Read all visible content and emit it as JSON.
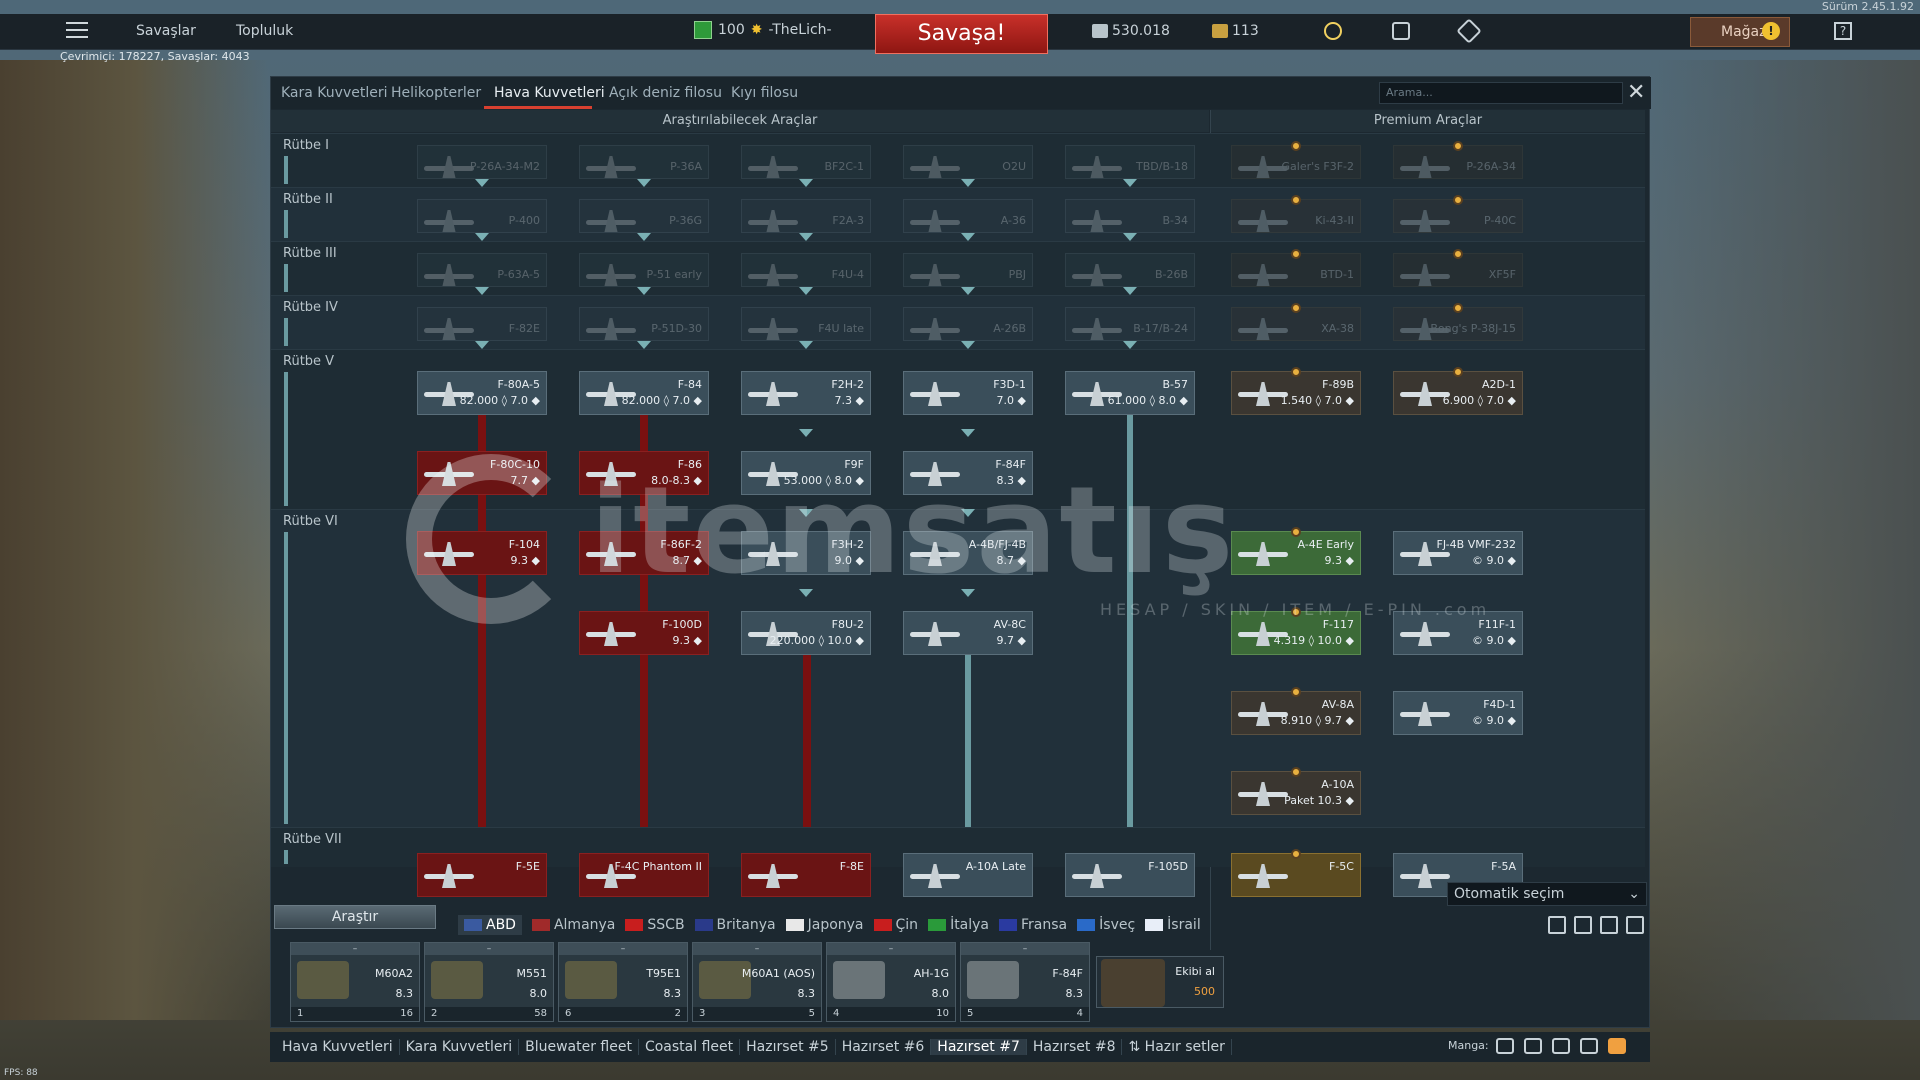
{
  "version": "Sürüm 2.45.1.92",
  "topbar": {
    "nav": [
      "Savaşlar",
      "Topluluk"
    ],
    "level": "100",
    "player": "-TheLich-",
    "battle_label": "Savaşa!",
    "silver": "530.018",
    "gold": "113",
    "shop_label": "Mağaza",
    "warn": "!",
    "help": "?"
  },
  "online": "Çevrimiçi: 178227, Savaşlar: 4043",
  "tabs": [
    "Kara Kuvvetleri",
    "Helikopterler",
    "Hava Kuvvetleri",
    "Açık deniz filosu",
    "Kıyı filosu"
  ],
  "search_placeholder": "Arama...",
  "columns": {
    "research": "Araştırılabilecek Araçlar",
    "premium": "Premium Araçlar"
  },
  "ranks": [
    "Rütbe I",
    "Rütbe II",
    "Rütbe III",
    "Rütbe IV",
    "Rütbe V",
    "Rütbe VI",
    "Rütbe VII"
  ],
  "faded_cards": [
    [
      "P-26A-34-M2",
      "P-36A",
      "BF2C-1",
      "O2U",
      "TBD/B-18",
      "Galer's F3F-2",
      "P-26A-34"
    ],
    [
      "P-400",
      "P-36G",
      "F2A-3",
      "A-36",
      "B-34",
      "Ki-43-II",
      "P-40C"
    ],
    [
      "P-63A-5",
      "P-51 early",
      "F4U-4",
      "PBJ",
      "B-26B",
      "BTD-1",
      "XF5F"
    ],
    [
      "F-82E",
      "P-51D-30",
      "F4U late",
      "A-26B",
      "B-17/B-24",
      "XA-38",
      "Bong's P-38J-15"
    ]
  ],
  "rank5": [
    {
      "name": "F-80A-5",
      "br": "82.000 ◊ 7.0 ◆",
      "style": "normal"
    },
    {
      "name": "F-84",
      "br": "82.000 ◊ 7.0 ◆",
      "style": "normal"
    },
    {
      "name": "F2H-2",
      "br": "7.3 ◆",
      "style": "normal"
    },
    {
      "name": "F3D-1",
      "br": "7.0 ◆",
      "style": "normal"
    },
    {
      "name": "B-57",
      "br": "61.000 ◊ 8.0 ◆",
      "style": "normal"
    },
    {
      "name": "F-89B",
      "br": "1.540 ◊ 7.0 ◆",
      "style": "prem"
    },
    {
      "name": "A2D-1",
      "br": "6.900 ◊ 7.0 ◆",
      "style": "prem"
    },
    {
      "name": "F-80C-10",
      "br": "7.7 ◆",
      "style": "red"
    },
    {
      "name": "F-86",
      "br": "8.0-8.3 ◆",
      "style": "red"
    },
    {
      "name": "F9F",
      "br": "53.000 ◊ 8.0 ◆",
      "style": "normal"
    },
    {
      "name": "F-84F",
      "br": "8.3 ◆",
      "style": "normal"
    }
  ],
  "rank6": [
    {
      "name": "F-104",
      "br": "9.3 ◆",
      "style": "red"
    },
    {
      "name": "F-86F-2",
      "br": "8.7 ◆",
      "style": "red"
    },
    {
      "name": "F3H-2",
      "br": "9.0 ◆",
      "style": "normal"
    },
    {
      "name": "A-4B/FJ-4B",
      "br": "8.7 ◆",
      "style": "normal"
    },
    {
      "name": "A-4E Early",
      "br": "9.3 ◆",
      "style": "green"
    },
    {
      "name": "FJ-4B VMF-232",
      "br": "© 9.0 ◆",
      "style": "normal"
    },
    {
      "name": "F-100D",
      "br": "9.3 ◆",
      "style": "red"
    },
    {
      "name": "F8U-2",
      "br": "220.000 ◊ 10.0 ◆",
      "style": "normal"
    },
    {
      "name": "AV-8C",
      "br": "9.7 ◆",
      "style": "normal"
    },
    {
      "name": "F-117",
      "br": "4.319 ◊ 10.0 ◆",
      "style": "green"
    },
    {
      "name": "F11F-1",
      "br": "© 9.0 ◆",
      "style": "normal"
    },
    {
      "name": "AV-8A",
      "br": "8.910 ◊ 9.7 ◆",
      "style": "prem"
    },
    {
      "name": "F4D-1",
      "br": "© 9.0 ◆",
      "style": "normal"
    },
    {
      "name": "A-10A",
      "br": "Paket 10.3 ◆",
      "style": "prem"
    }
  ],
  "rank7": [
    {
      "name": "F-5E",
      "style": "red"
    },
    {
      "name": "F-4C Phantom II",
      "style": "red"
    },
    {
      "name": "F-8E",
      "style": "red"
    },
    {
      "name": "A-10A Late",
      "style": "normal"
    },
    {
      "name": "F-105D",
      "style": "normal"
    },
    {
      "name": "F-5C",
      "style": "gold"
    },
    {
      "name": "F-5A",
      "style": "normal"
    }
  ],
  "autosel": "Otomatik seçim",
  "research_label": "Araştır",
  "nations": [
    "ABD",
    "Almanya",
    "SSCB",
    "Britanya",
    "Japonya",
    "Çin",
    "İtalya",
    "Fransa",
    "İsveç",
    "İsrail"
  ],
  "nation_colors": [
    "#3a5aa0",
    "#a02a2a",
    "#c81e1e",
    "#2a3a8a",
    "#e8e8e8",
    "#c81e1e",
    "#2a9a3a",
    "#2a3aa0",
    "#2a6ac8",
    "#e8eef8"
  ],
  "crew": [
    {
      "name": "M60A2",
      "br": "8.3",
      "slot": "1",
      "count": "16"
    },
    {
      "name": "M551",
      "br": "8.0",
      "slot": "2",
      "count": "58"
    },
    {
      "name": "T95E1",
      "br": "8.3",
      "slot": "6",
      "count": "2"
    },
    {
      "name": "M60A1 (AOS)",
      "br": "8.3",
      "slot": "3",
      "count": "5"
    },
    {
      "name": "AH-1G",
      "br": "8.0",
      "slot": "4",
      "count": "10"
    },
    {
      "name": "F-84F",
      "br": "8.3",
      "slot": "5",
      "count": "4"
    }
  ],
  "crew_add": {
    "label": "Ekibi al",
    "cost": "500"
  },
  "presets": [
    "Hava Kuvvetleri",
    "Kara Kuvvetleri",
    "Bluewater fleet",
    "Coastal fleet",
    "Hazırset #5",
    "Hazırset #6",
    "Hazırset #7",
    "Hazırset #8",
    "⇅ Hazır setler"
  ],
  "squad_label": "Manga:",
  "fps": "FPS: 88",
  "watermark": {
    "title": "itemsatış",
    "sub": "HESAP / SKIN / ITEM / E-PIN .com"
  }
}
